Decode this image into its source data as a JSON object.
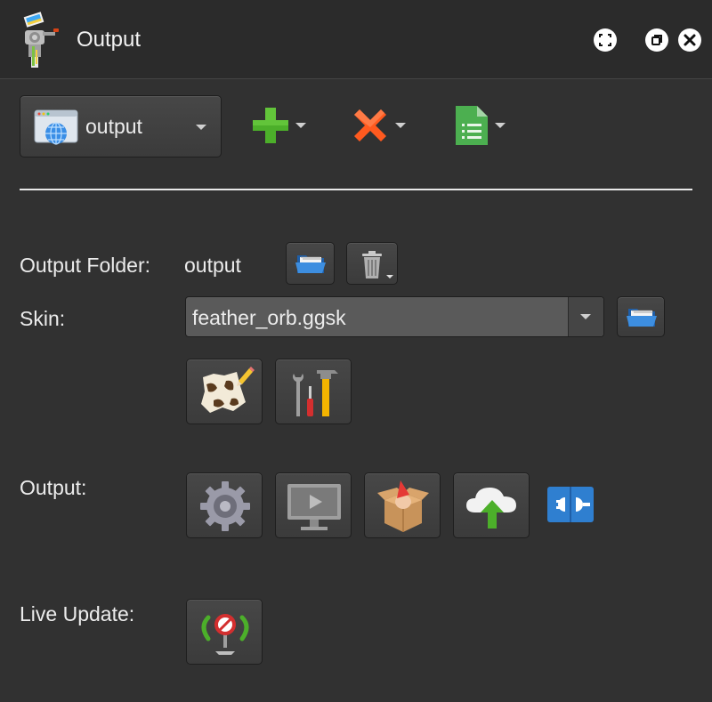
{
  "window": {
    "title": "Output"
  },
  "toolbar": {
    "output_select_value": "output"
  },
  "fields": {
    "output_folder_label": "Output Folder:",
    "output_folder_value": "output",
    "skin_label": "Skin:",
    "skin_value": "feather_orb.ggsk",
    "output_label": "Output:",
    "live_update_label": "Live Update:"
  },
  "icons": {
    "app": "blender-app-icon",
    "fullscreen": "fullscreen-icon",
    "restore": "restore-window-icon",
    "close": "close-icon",
    "add": "plus-icon",
    "remove": "x-icon",
    "sheet": "spreadsheet-icon",
    "folder": "open-folder-icon",
    "trash": "trash-icon",
    "skin_editor": "skin-editor-icon",
    "tools": "tools-icon",
    "settings": "gear-icon",
    "preview": "monitor-play-icon",
    "package": "package-box-icon",
    "upload": "cloud-upload-icon",
    "plugin": "plugin-connector-icon",
    "live_update": "live-update-disabled-icon"
  },
  "colors": {
    "accent_green": "#4caf2a",
    "accent_red": "#ff5a1f",
    "accent_blue": "#2f7fd0"
  }
}
